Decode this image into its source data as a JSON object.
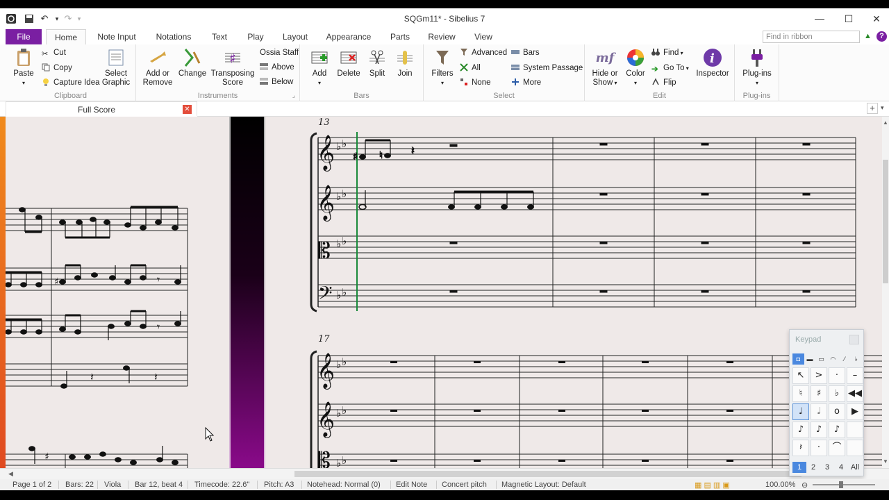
{
  "window": {
    "title": "SQGm11* - Sibelius 7"
  },
  "tabs": [
    "File",
    "Home",
    "Note Input",
    "Notations",
    "Text",
    "Play",
    "Layout",
    "Appearance",
    "Parts",
    "Review",
    "View"
  ],
  "active_tab": "Home",
  "ribbon_search_placeholder": "Find in ribbon",
  "ribbon": {
    "clipboard": {
      "label": "Clipboard",
      "paste": "Paste",
      "cut": "Cut",
      "copy": "Copy",
      "capture_idea": "Capture Idea",
      "select_graphic_1": "Select",
      "select_graphic_2": "Graphic"
    },
    "instruments": {
      "label": "Instruments",
      "add_remove_1": "Add or",
      "add_remove_2": "Remove",
      "change": "Change",
      "transposing_1": "Transposing",
      "transposing_2": "Score",
      "ossia_staff": "Ossia Staff",
      "above": "Above",
      "below": "Below"
    },
    "bars": {
      "label": "Bars",
      "add": "Add",
      "delete": "Delete",
      "split": "Split",
      "join": "Join"
    },
    "select": {
      "label": "Select",
      "filters": "Filters",
      "advanced": "Advanced",
      "all": "All",
      "none": "None",
      "bars": "Bars",
      "system_passage": "System Passage",
      "more": "More"
    },
    "edit": {
      "label": "Edit",
      "hide_show_1": "Hide or",
      "hide_show_2": "Show",
      "color": "Color",
      "find": "Find",
      "go_to": "Go To",
      "flip": "Flip",
      "inspector": "Inspector"
    },
    "plugins": {
      "label": "Plug-ins",
      "plugins": "Plug-ins"
    }
  },
  "document_tab": "Full Score",
  "score": {
    "system1_bar": "13",
    "system2_bar": "17"
  },
  "keypad": {
    "title": "Keypad",
    "tabs": [
      "◘",
      "▬",
      "▭",
      "◠",
      "⁄",
      "♭"
    ],
    "keys": [
      "↖",
      ">",
      "·",
      "–",
      "♮",
      "♯",
      "♭",
      "◀◀",
      "♩",
      "𝅗𝅥",
      "o",
      "▶",
      "♪",
      "♪",
      "♪",
      "",
      "𝄽",
      "·",
      "⌒",
      ""
    ],
    "layouts": [
      "1",
      "2",
      "3",
      "4",
      "All"
    ]
  },
  "status": {
    "page": "Page 1 of 2",
    "bars": "Bars: 22",
    "instrument": "Viola",
    "position": "Bar 12, beat 4",
    "timecode": "Timecode: 22.6\"",
    "pitch": "Pitch: A3",
    "notehead": "Notehead: Normal (0)",
    "mode": "Edit Note",
    "concert": "Concert pitch",
    "magnetic": "Magnetic Layout: Default",
    "zoom": "100.00%"
  },
  "colors": {
    "file_tab": "#7a1fa2",
    "paper": "#efe9e8",
    "keypad_selected": "#4a88df",
    "playback_line": "#1a8a3a"
  }
}
